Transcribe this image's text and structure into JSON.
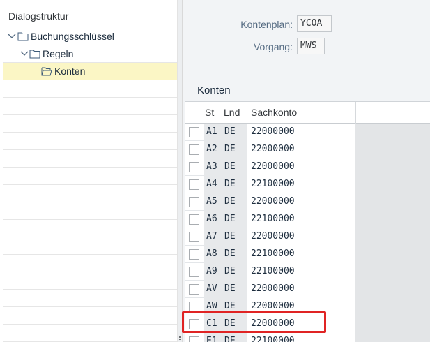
{
  "dialog": {
    "title": "Dialogstruktur",
    "tree": [
      {
        "label": "Buchungsschlüssel",
        "expanded": true,
        "level": 0,
        "icon": "folder-icon"
      },
      {
        "label": "Regeln",
        "expanded": true,
        "level": 1,
        "icon": "folder-icon"
      },
      {
        "label": "Konten",
        "selected": true,
        "level": 2,
        "icon": "open-folder-icon"
      }
    ]
  },
  "form": {
    "kontenplan_label": "Kontenplan:",
    "kontenplan_value": "YCOA",
    "vorgang_label": "Vorgang:",
    "vorgang_value": "MWS"
  },
  "table": {
    "title": "Konten",
    "columns": [
      "St",
      "Lnd",
      "Sachkonto"
    ],
    "rows": [
      {
        "st": "A1",
        "lnd": "DE",
        "sachkonto": "22000000"
      },
      {
        "st": "A2",
        "lnd": "DE",
        "sachkonto": "22000000"
      },
      {
        "st": "A3",
        "lnd": "DE",
        "sachkonto": "22000000"
      },
      {
        "st": "A4",
        "lnd": "DE",
        "sachkonto": "22100000"
      },
      {
        "st": "A5",
        "lnd": "DE",
        "sachkonto": "22000000"
      },
      {
        "st": "A6",
        "lnd": "DE",
        "sachkonto": "22100000"
      },
      {
        "st": "A7",
        "lnd": "DE",
        "sachkonto": "22000000"
      },
      {
        "st": "A8",
        "lnd": "DE",
        "sachkonto": "22100000"
      },
      {
        "st": "A9",
        "lnd": "DE",
        "sachkonto": "22100000"
      },
      {
        "st": "AV",
        "lnd": "DE",
        "sachkonto": "22000000"
      },
      {
        "st": "AW",
        "lnd": "DE",
        "sachkonto": "22000000"
      },
      {
        "st": "C1",
        "lnd": "DE",
        "sachkonto": "22000000",
        "highlighted": true
      },
      {
        "st": "E1",
        "lnd": "DE",
        "sachkonto": "22100000"
      }
    ]
  },
  "colors": {
    "selected_tree_row": "#fbf6c5",
    "highlight_border": "#e02424",
    "panel_bg": "#f2f4f6"
  }
}
